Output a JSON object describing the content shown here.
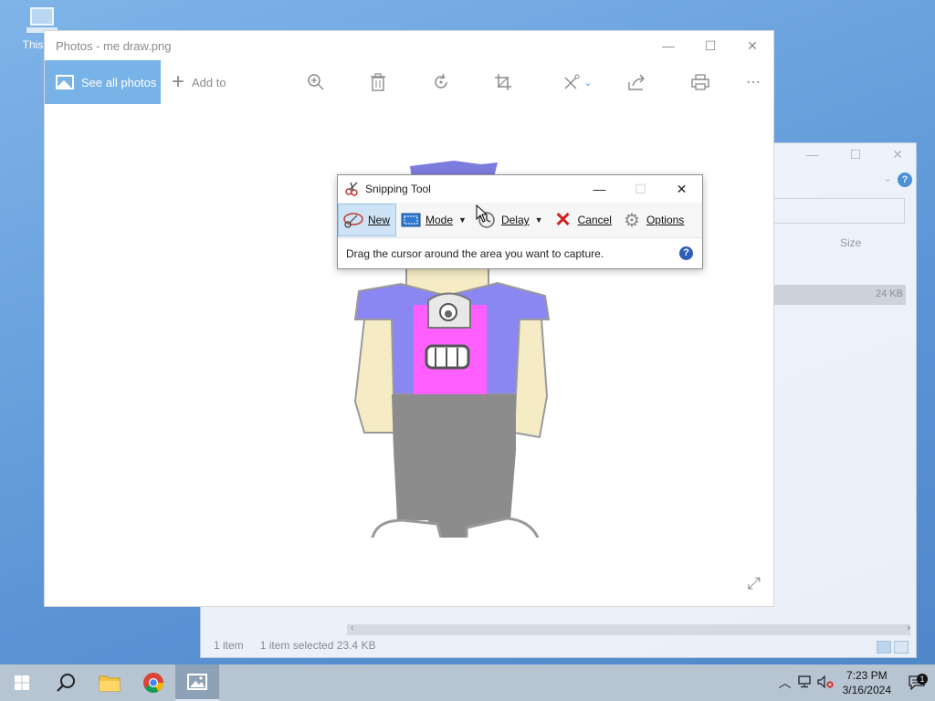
{
  "desktop": {
    "icon_label": "This PC"
  },
  "explorer": {
    "col_size": "Size",
    "row_size": "24 KB",
    "status_count": "1 item",
    "status_selected": "1 item selected",
    "status_size": "23.4 KB"
  },
  "photos": {
    "title": "Photos - me draw.png",
    "see_all": "See all photos",
    "add_to": "Add to",
    "accent": "#78b3e8"
  },
  "snip": {
    "title": "Snipping Tool",
    "new": "New",
    "mode": "Mode",
    "delay": "Delay",
    "cancel": "Cancel",
    "options": "Options",
    "message": "Drag the cursor around the area you want to capture.",
    "help": "?"
  },
  "taskbar": {
    "time": "7:23 PM",
    "date": "3/16/2024",
    "notification_count": "1"
  },
  "icons": [
    "windows-logo",
    "search",
    "file-explorer",
    "chrome",
    "photos",
    "zoom-in",
    "trash",
    "rotate",
    "crop",
    "edit",
    "share",
    "print",
    "more",
    "expand",
    "network",
    "volume-muted",
    "chevron-up",
    "notification"
  ]
}
